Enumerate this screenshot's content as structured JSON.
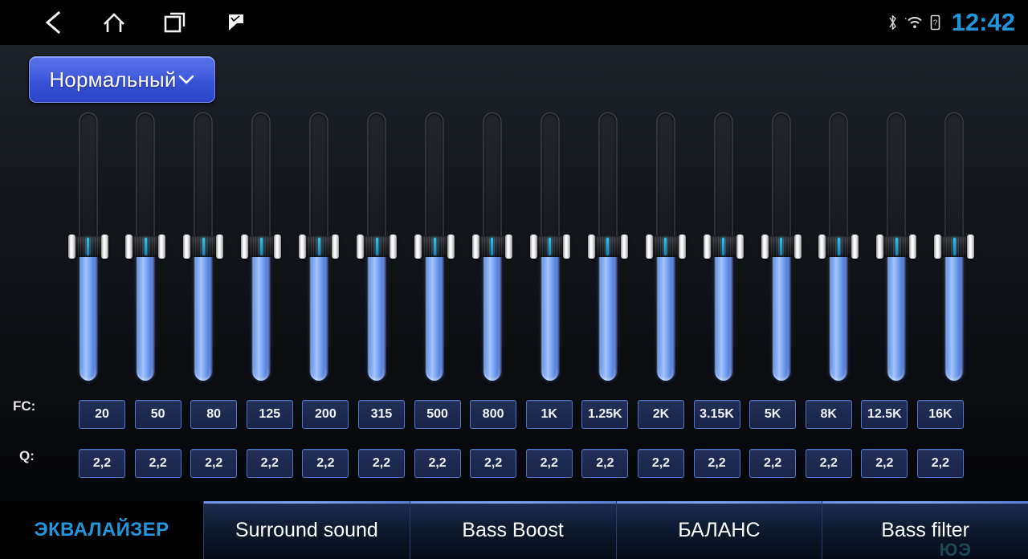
{
  "statusbar": {
    "nav": [
      {
        "name": "back-button",
        "icon": "back-icon"
      },
      {
        "name": "home-button",
        "icon": "home-icon"
      },
      {
        "name": "recents-button",
        "icon": "recents-icon"
      },
      {
        "name": "flag-button",
        "icon": "flag-icon"
      }
    ],
    "icons": {
      "bluetooth": "bluetooth-icon",
      "wifi": "wifi-icon",
      "sim": "sim-card-icon"
    },
    "clock": "12:42",
    "clock_color": "#2196dd"
  },
  "preset": {
    "label": "Нормальный",
    "caret": "⌄",
    "accent": "#4560e0"
  },
  "equalizer": {
    "fc_label": "FC:",
    "q_label": "Q:",
    "band_count": 16,
    "fc_values": [
      "20",
      "50",
      "80",
      "125",
      "200",
      "315",
      "500",
      "800",
      "1K",
      "1.25K",
      "2K",
      "3.15K",
      "5K",
      "8K",
      "12.5K",
      "16K"
    ],
    "q_values": [
      "2,2",
      "2,2",
      "2,2",
      "2,2",
      "2,2",
      "2,2",
      "2,2",
      "2,2",
      "2,2",
      "2,2",
      "2,2",
      "2,2",
      "2,2",
      "2,2",
      "2,2",
      "2,2"
    ],
    "slider_positions_pct": [
      50,
      50,
      50,
      50,
      50,
      50,
      50,
      50,
      50,
      50,
      50,
      50,
      50,
      50,
      50,
      50
    ],
    "fill_color": "#7ba6f2",
    "cell_border_color": "#4f74c4"
  },
  "tabs": [
    {
      "label": "ЭКВАЛАЙЗЕР",
      "active": true
    },
    {
      "label": "Surround sound",
      "active": false
    },
    {
      "label": "Bass Boost",
      "active": false
    },
    {
      "label": "БАЛАНС",
      "active": false
    },
    {
      "label": "Bass filter",
      "active": false
    }
  ],
  "watermark": "ЮЭ"
}
